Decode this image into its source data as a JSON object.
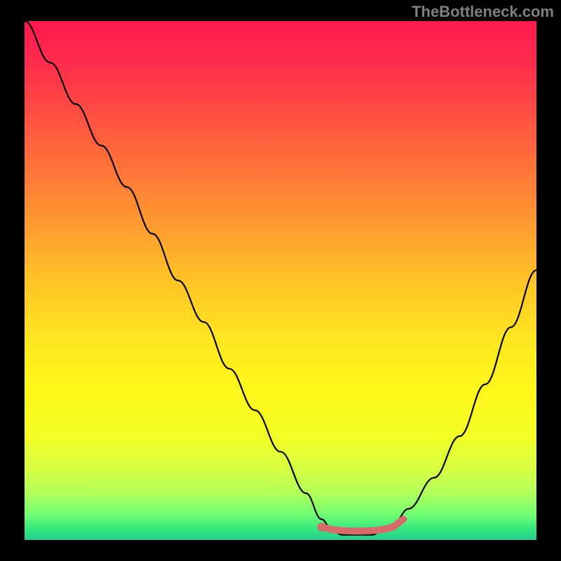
{
  "watermark": "TheBottleneck.com",
  "chart_data": {
    "type": "line",
    "title": "",
    "xlabel": "",
    "ylabel": "",
    "xlim": [
      0,
      100
    ],
    "ylim": [
      0,
      100
    ],
    "series": [
      {
        "name": "bottleneck-curve",
        "x": [
          0,
          5,
          10,
          15,
          20,
          25,
          30,
          35,
          40,
          45,
          50,
          55,
          58,
          60,
          62,
          65,
          68,
          70,
          72,
          75,
          80,
          85,
          90,
          95,
          100
        ],
        "values": [
          100,
          92,
          84,
          76,
          68,
          59,
          50,
          42,
          33,
          25,
          17,
          9,
          4,
          2,
          1,
          1,
          1,
          2,
          3,
          6,
          12,
          20,
          30,
          41,
          52
        ],
        "color": "#000000"
      },
      {
        "name": "optimal-marker",
        "x": [
          58,
          60,
          62,
          64,
          66,
          68,
          70,
          72,
          74
        ],
        "values": [
          2.5,
          2,
          1.8,
          1.7,
          1.7,
          1.8,
          2,
          2.5,
          4
        ],
        "color": "#d96a6a"
      }
    ],
    "gradient_stops": [
      {
        "pos": 0,
        "color": "#ff1a4d"
      },
      {
        "pos": 0.08,
        "color": "#ff2b4d"
      },
      {
        "pos": 0.2,
        "color": "#ff5640"
      },
      {
        "pos": 0.35,
        "color": "#ff8b33"
      },
      {
        "pos": 0.5,
        "color": "#ffc326"
      },
      {
        "pos": 0.62,
        "color": "#ffe81f"
      },
      {
        "pos": 0.72,
        "color": "#fff81a"
      },
      {
        "pos": 0.8,
        "color": "#f3ff26"
      },
      {
        "pos": 0.86,
        "color": "#d9ff40"
      },
      {
        "pos": 0.91,
        "color": "#b0ff59"
      },
      {
        "pos": 0.95,
        "color": "#73ff73"
      },
      {
        "pos": 0.98,
        "color": "#33e680"
      },
      {
        "pos": 1.0,
        "color": "#26cc8c"
      }
    ]
  }
}
